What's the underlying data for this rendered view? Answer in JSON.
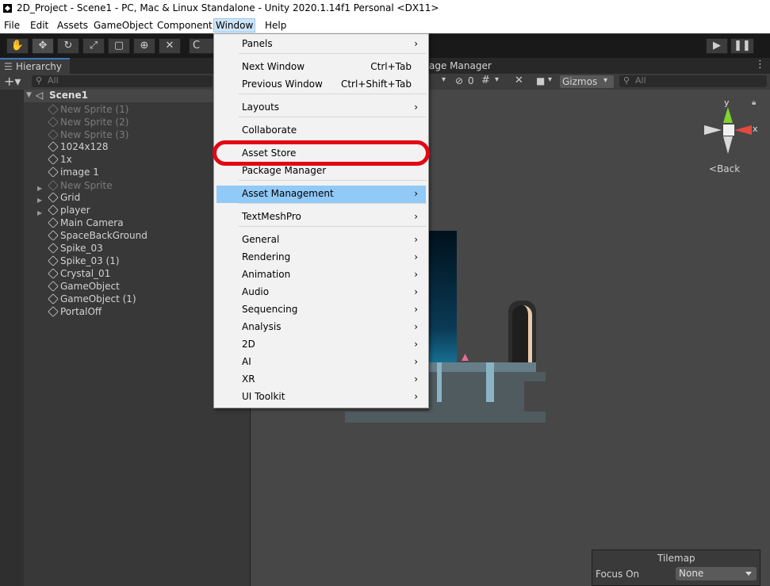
{
  "window": {
    "title": "2D_Project - Scene1 - PC, Mac & Linux Standalone - Unity 2020.1.14f1 Personal <DX11>"
  },
  "menubar": [
    "File",
    "Edit",
    "Assets",
    "GameObject",
    "Component",
    "Window",
    "Help"
  ],
  "toolbar": {
    "center_label": "C",
    "play_icon": "play-icon",
    "pause_icon": "pause-icon"
  },
  "hierarchy": {
    "tab_label": "Hierarchy",
    "search_placeholder": "All",
    "scene_name": "Scene1",
    "items": [
      {
        "label": "New Sprite (1)",
        "dim": true
      },
      {
        "label": "New Sprite (2)",
        "dim": true
      },
      {
        "label": "New Sprite (3)",
        "dim": true
      },
      {
        "label": "1024x128",
        "dim": false
      },
      {
        "label": "1x",
        "dim": false
      },
      {
        "label": "image 1",
        "dim": false
      },
      {
        "label": "New Sprite",
        "dim": true,
        "foldout": true
      },
      {
        "label": "Grid",
        "dim": false,
        "foldout": true
      },
      {
        "label": "player",
        "dim": false,
        "foldout": true
      },
      {
        "label": "Main Camera",
        "dim": false
      },
      {
        "label": "SpaceBackGround",
        "dim": false
      },
      {
        "label": "Spike_03",
        "dim": false
      },
      {
        "label": "Spike_03 (1)",
        "dim": false
      },
      {
        "label": "Crystal_01",
        "dim": false
      },
      {
        "label": "GameObject",
        "dim": false
      },
      {
        "label": "GameObject (1)",
        "dim": false
      },
      {
        "label": "PortalOff",
        "dim": false
      }
    ]
  },
  "scene": {
    "tab_label_partial": "age Manager",
    "hidden_count": "0",
    "gizmos_label": "Gizmos",
    "search_placeholder": "All",
    "axis_y": "y",
    "axis_x": "x",
    "back_label": "Back",
    "tilemap_title": "Tilemap",
    "focus_on_label": "Focus On",
    "focus_on_value": "None"
  },
  "window_menu": {
    "items": [
      {
        "label": "Panels",
        "submenu": true
      },
      {
        "label": "Next Window",
        "shortcut": "Ctrl+Tab"
      },
      {
        "label": "Previous Window",
        "shortcut": "Ctrl+Shift+Tab"
      },
      {
        "label": "Layouts",
        "submenu": true
      },
      {
        "label": "Collaborate"
      },
      {
        "label": "Asset Store",
        "circled": true
      },
      {
        "label": "Package Manager"
      },
      {
        "label": "Asset Management",
        "submenu": true,
        "highlighted": true
      },
      {
        "label": "TextMeshPro",
        "submenu": true
      },
      {
        "label": "General",
        "submenu": true
      },
      {
        "label": "Rendering",
        "submenu": true
      },
      {
        "label": "Animation",
        "submenu": true
      },
      {
        "label": "Audio",
        "submenu": true
      },
      {
        "label": "Sequencing",
        "submenu": true
      },
      {
        "label": "Analysis",
        "submenu": true
      },
      {
        "label": "2D",
        "submenu": true
      },
      {
        "label": "AI",
        "submenu": true
      },
      {
        "label": "XR",
        "submenu": true
      },
      {
        "label": "UI Toolkit",
        "submenu": true
      }
    ],
    "submenu_arrow": "›"
  },
  "colors": {
    "highlight": "#91c9f7",
    "annotation": "#e30613",
    "accent": "#3a79bb"
  }
}
